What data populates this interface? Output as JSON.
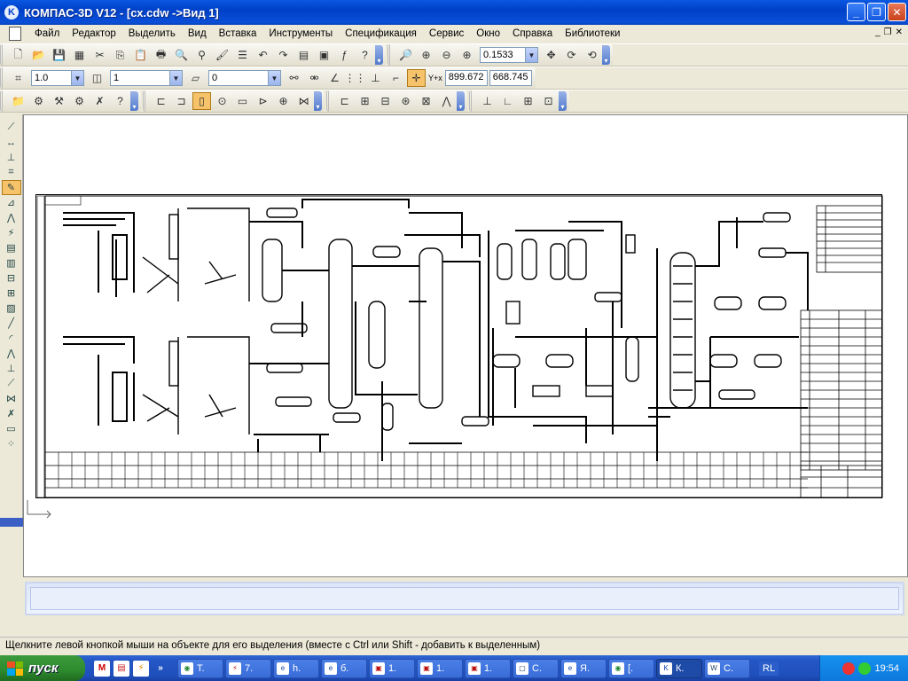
{
  "window": {
    "title": "КОМПАС-3D V12 - [сх.cdw ->Вид 1]",
    "app_icon": "K",
    "minimize": "_",
    "maximize": "❐",
    "close": "✕"
  },
  "menu": {
    "items": [
      "Файл",
      "Редактор",
      "Выделить",
      "Вид",
      "Вставка",
      "Инструменты",
      "Спецификация",
      "Сервис",
      "Окно",
      "Справка",
      "Библиотеки"
    ],
    "mdi_buttons": [
      "_",
      "❐",
      "✕"
    ]
  },
  "toolbar": {
    "zoom_value": "0.1533",
    "line_scale": "1.0",
    "layer_value": "1",
    "style_value": "0",
    "coord_x": "899.672",
    "coord_y": "668.745",
    "coord_label": "Y+x"
  },
  "status": {
    "hint": "Щелкните левой кнопкой мыши на объекте для его выделения (вместе с Ctrl или Shift - добавить к выделенным)"
  },
  "taskbar": {
    "start_label": "пуск",
    "tasks": [
      "Т.",
      "7.",
      "h.",
      "б.",
      "1.",
      "1.",
      "1.",
      "С.",
      "Я.",
      "[.",
      "К.",
      "С."
    ],
    "lang": "RL",
    "clock": "19:54"
  }
}
